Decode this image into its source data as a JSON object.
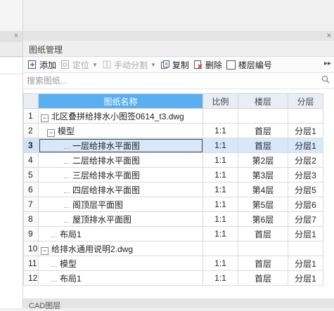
{
  "panel": {
    "title": "图纸管理",
    "close_glyph": "×",
    "left_close_glyph": "×"
  },
  "toolbar": {
    "add": "添加",
    "locate": "定位",
    "split": "手动分割",
    "copy": "复制",
    "delete": "删除",
    "floor_number": "楼层编号",
    "more": "▸▸"
  },
  "search": {
    "placeholder": "搜索图纸..."
  },
  "table": {
    "headers": {
      "name": "图纸名称",
      "ratio": "比例",
      "floor": "楼层",
      "layer": "分层"
    },
    "rows": [
      {
        "num": "1",
        "name": "北区叠拼给排水小图签0614_t3.dwg",
        "ratio": "",
        "floor": "",
        "layer": ""
      },
      {
        "num": "2",
        "name": "模型",
        "ratio": "1:1",
        "floor": "首层",
        "layer": "分层1"
      },
      {
        "num": "3",
        "name": "一层给排水平面图",
        "ratio": "1:1",
        "floor": "首层",
        "layer": "分层1"
      },
      {
        "num": "4",
        "name": "二层给排水平面图",
        "ratio": "1:1",
        "floor": "第2层",
        "layer": "分层2"
      },
      {
        "num": "5",
        "name": "三层给排水平面图",
        "ratio": "1:1",
        "floor": "第3层",
        "layer": "分层3"
      },
      {
        "num": "6",
        "name": "四层给排水平面图",
        "ratio": "1:1",
        "floor": "第4层",
        "layer": "分层5"
      },
      {
        "num": "7",
        "name": "阁顶层平面图",
        "ratio": "1:1",
        "floor": "第5层",
        "layer": "分层6"
      },
      {
        "num": "8",
        "name": "屋顶排水平面图",
        "ratio": "1:1",
        "floor": "第6层",
        "layer": "分层7"
      },
      {
        "num": "9",
        "name": "布局1",
        "ratio": "1:1",
        "floor": "首层",
        "layer": "分层1"
      },
      {
        "num": "10",
        "name": "给排水通用说明2.dwg",
        "ratio": "",
        "floor": "",
        "layer": ""
      },
      {
        "num": "11",
        "name": "模型",
        "ratio": "1:1",
        "floor": "首层",
        "layer": "分层1"
      },
      {
        "num": "12",
        "name": "布局1",
        "ratio": "1:1",
        "floor": "首层",
        "layer": "分层1"
      }
    ]
  },
  "bottom_panel": {
    "title": "CAD图层"
  }
}
